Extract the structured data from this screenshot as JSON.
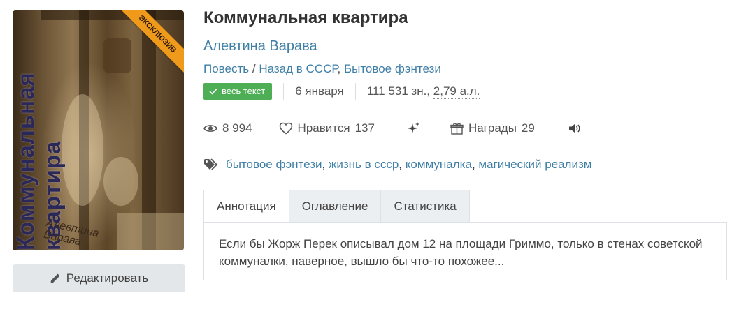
{
  "cover": {
    "title_text": "Коммунальная квартира",
    "author_text": "Алевтина Варава",
    "ribbon": "ЭКСКЛЮЗИВ"
  },
  "edit_button": {
    "label": "Редактировать",
    "icon": "pencil-icon"
  },
  "book": {
    "title": "Коммунальная квартира",
    "author": "Алевтина Варава",
    "form": "Повесть",
    "genre_separator": "/",
    "genres": [
      "Назад в СССР",
      "Бытовое фэнтези"
    ]
  },
  "meta": {
    "badge": "весь текст",
    "date": "6 января",
    "size_chars": "111 531 зн., ",
    "size_sheets": "2,79 а.л."
  },
  "stats": {
    "views": "8 994",
    "likes_label": "Нравится",
    "likes": "137",
    "awards_label": "Награды",
    "awards": "29"
  },
  "tags": [
    "бытовое фэнтези",
    "жизнь в ссср",
    "коммуналка",
    "магический реализм"
  ],
  "tabs": [
    "Аннотация",
    "Оглавление",
    "Статистика"
  ],
  "annotation": "Если бы Жорж Перек описывал дом 12 на площади Гриммо, только в стенах советской коммуналки, наверное, вышло бы что-то похожее...",
  "colors": {
    "link": "#3f7fa6",
    "badge": "#4eae56",
    "ribbon": "#f09a1c"
  }
}
